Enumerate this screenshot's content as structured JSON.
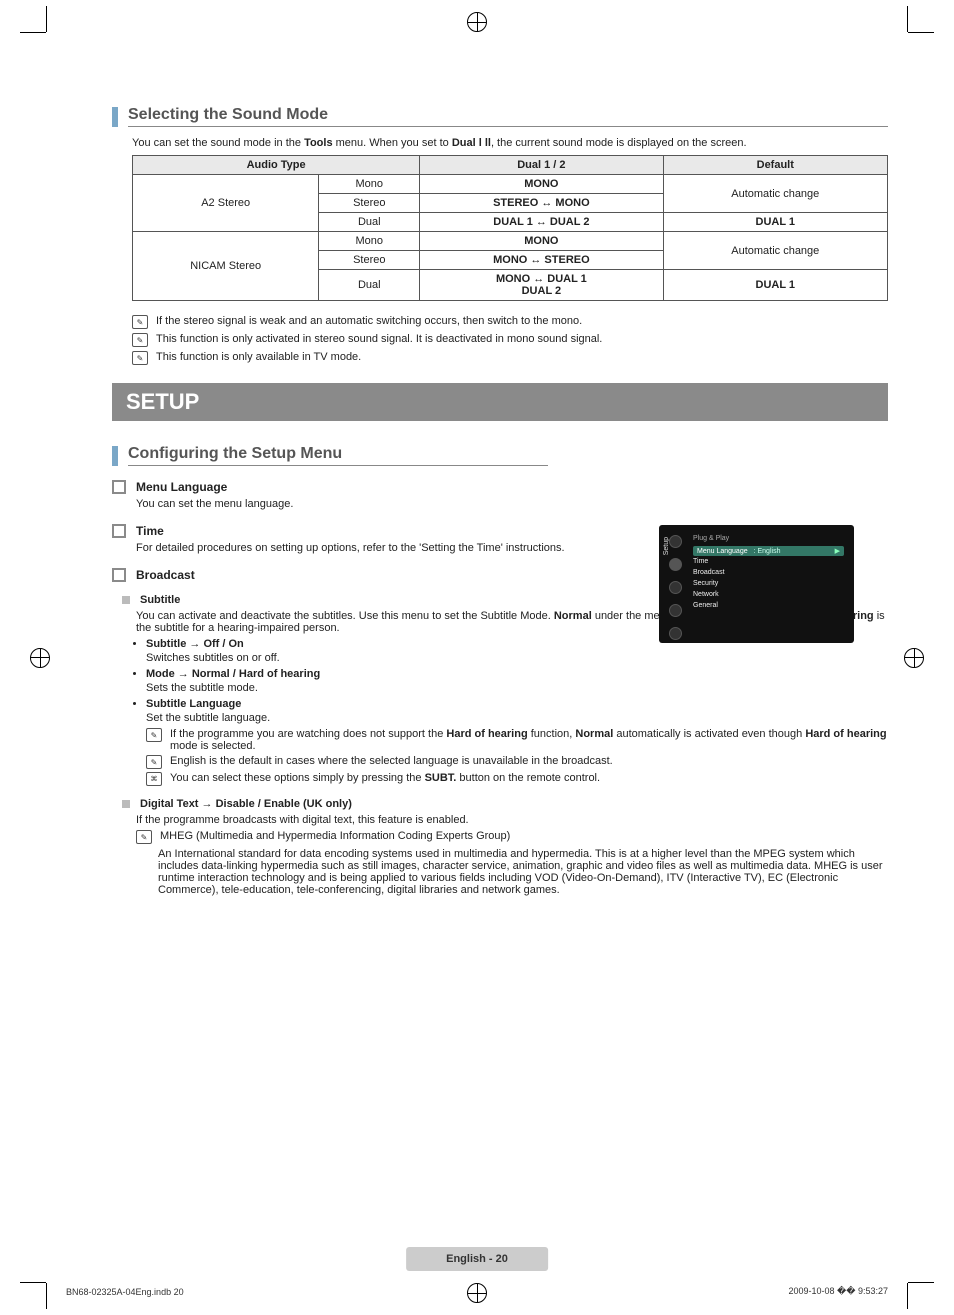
{
  "sound": {
    "heading": "Selecting the Sound Mode",
    "intro_pre": "You can set the sound mode in the ",
    "intro_tools": "Tools",
    "intro_mid": " menu. When you set to ",
    "intro_dual": "Dual l ll",
    "intro_post": ", the current sound mode is displayed on the screen.",
    "th1": "Audio Type",
    "th2": "Dual 1 / 2",
    "th3": "Default",
    "rowA_name": "A2 Stereo",
    "rowA_r1c1": "Mono",
    "rowA_r1c2": "MONO",
    "rowA_r12c3": "Automatic change",
    "rowA_r2c1": "Stereo",
    "rowA_r2c2": "STEREO ↔ MONO",
    "rowA_r3c1": "Dual",
    "rowA_r3c2": "DUAL 1 ↔ DUAL 2",
    "rowA_r3c3": "DUAL 1",
    "rowB_name": "NICAM Stereo",
    "rowB_r1c1": "Mono",
    "rowB_r1c2": "MONO",
    "rowB_r12c3": "Automatic change",
    "rowB_r2c1": "Stereo",
    "rowB_r2c2": "MONO ↔ STEREO",
    "rowB_r3c1": "Dual",
    "rowB_r3c2a": "MONO ↔ DUAL 1",
    "rowB_r3c2b": "DUAL 2",
    "rowB_r3c3": "DUAL 1",
    "note1": "If the stereo signal is weak and an automatic switching occurs, then switch to the mono.",
    "note2": "This function is only activated in stereo sound signal. It is deactivated in mono sound signal.",
    "note3": "This function is only available in TV mode."
  },
  "setup": {
    "band": "SETUP",
    "config_heading": "Configuring the Setup Menu",
    "menu_lang_h": "Menu Language",
    "menu_lang_t": "You can set the menu language.",
    "time_h": "Time",
    "time_t": "For detailed procedures on setting up options, refer to the 'Setting the Time' instructions.",
    "broadcast_h": "Broadcast",
    "subtitle_h": "Subtitle",
    "subtitle_t_pre": "You can activate and deactivate the subtitles. Use this menu to set the Subtitle Mode. ",
    "subtitle_t_bold1": "Normal",
    "subtitle_t_mid": " under the menu is the basic subtitle and ",
    "subtitle_t_bold2": "Hard of hearing",
    "subtitle_t_post": " is the subtitle for a hearing-impaired person.",
    "sub_b1_h": "Subtitle → Off / On",
    "sub_b1_t": "Switches subtitles on or off.",
    "sub_b2_h": "Mode → Normal / Hard of hearing",
    "sub_b2_t": "Sets the subtitle mode.",
    "sub_b3_h": "Subtitle Language",
    "sub_b3_t": "Set the subtitle language.",
    "sub_b3_n1_pre": "If the programme you are watching does not support the ",
    "sub_b3_n1_b1": "Hard of hearing",
    "sub_b3_n1_mid": " function, ",
    "sub_b3_n1_b2": "Normal",
    "sub_b3_n1_post1": " automatically is activated even though ",
    "sub_b3_n1_b3": "Hard of hearing",
    "sub_b3_n1_post2": " mode is selected.",
    "sub_b3_n2": "English is the default in cases where the selected language is unavailable in the broadcast.",
    "sub_b3_n3_pre": "You can select these options simply by pressing the ",
    "sub_b3_n3_btn": "SUBT.",
    "sub_b3_n3_post": " button on the remote control.",
    "digtext_h": "Digital Text → Disable / Enable (UK only)",
    "digtext_t": "If the programme broadcasts with digital text, this feature is enabled.",
    "digtext_n_h": "MHEG (Multimedia and Hypermedia Information Coding Experts Group)",
    "digtext_n_t": "An International standard for data encoding systems used in multimedia and hypermedia. This is at a higher level than the MPEG system which includes data-linking hypermedia such as still images, character service, animation, graphic and video files as well as multimedia data. MHEG is user runtime interaction technology and is being applied to various fields including VOD (Video-On-Demand), ITV (Interactive TV), EC (Electronic Commerce), tele-education, tele-conferencing, digital libraries and network games."
  },
  "tv": {
    "side": "Setup",
    "m0": "Plug & Play",
    "m1": "Menu Language",
    "m1v": ": English",
    "m2": "Time",
    "m3": "Broadcast",
    "m4": "Security",
    "m5": "Network",
    "m6": "General",
    "arrow": "▶"
  },
  "footer": {
    "pill": "English - 20",
    "left": "BN68-02325A-04Eng.indb   20",
    "right": "2009-10-08   �� 9:53:27"
  },
  "icons": {
    "note": "✎",
    "key": "⌘"
  }
}
